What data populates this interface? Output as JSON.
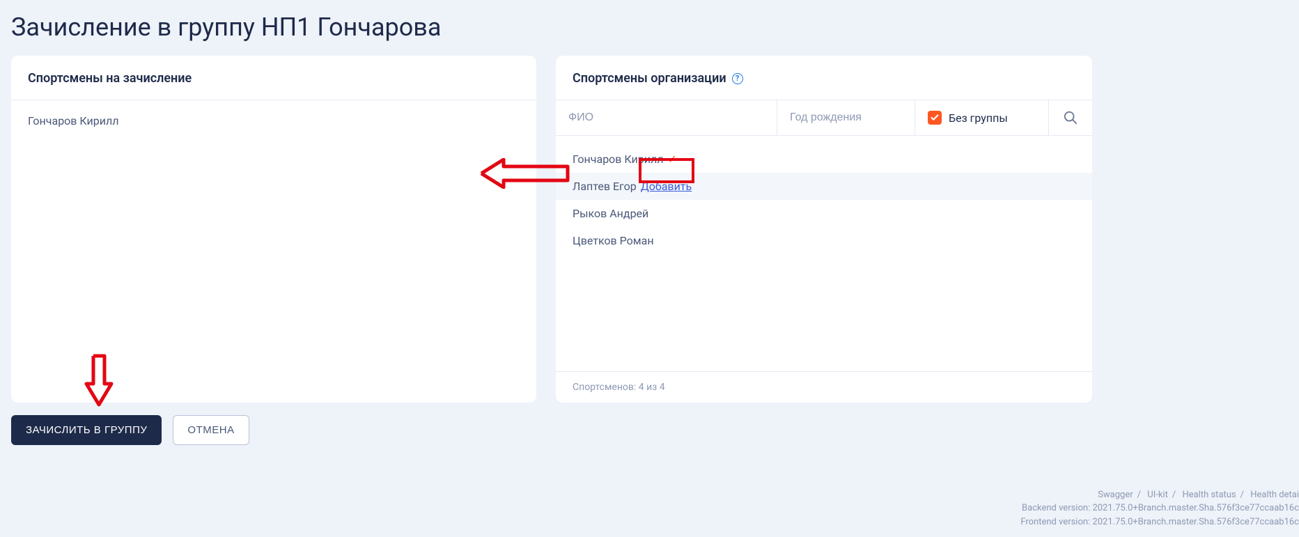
{
  "page": {
    "title": "Зачисление в группу НП1 Гончарова"
  },
  "left_panel": {
    "title": "Спортсмены на зачисление",
    "items": [
      {
        "name": "Гончаров Кирилл"
      }
    ]
  },
  "right_panel": {
    "title": "Спортсмены организации",
    "filters": {
      "fio_placeholder": "ФИО",
      "year_placeholder": "Год рождения",
      "no_group_label": "Без группы",
      "no_group_checked": true
    },
    "athletes": [
      {
        "name": "Гончаров Кирилл",
        "added": true
      },
      {
        "name": "Лаптев Егор",
        "add_label": "Добавить",
        "hovered": true
      },
      {
        "name": "Рыков Андрей"
      },
      {
        "name": "Цветков Роман"
      }
    ],
    "footer": "Спортсменов: 4 из 4"
  },
  "actions": {
    "enroll": "ЗАЧИСЛИТЬ В ГРУППУ",
    "cancel": "ОТМЕНА"
  },
  "footer": {
    "links": {
      "swagger": "Swagger",
      "uikit": "UI-kit",
      "health_status": "Health status",
      "health_detail": "Health detai"
    },
    "backend": "Backend version: 2021.75.0+Branch.master.Sha.576f3ce77ccaab16c",
    "frontend": "Frontend version: 2021.75.0+Branch.master.Sha.576f3ce77ccaab16c"
  }
}
